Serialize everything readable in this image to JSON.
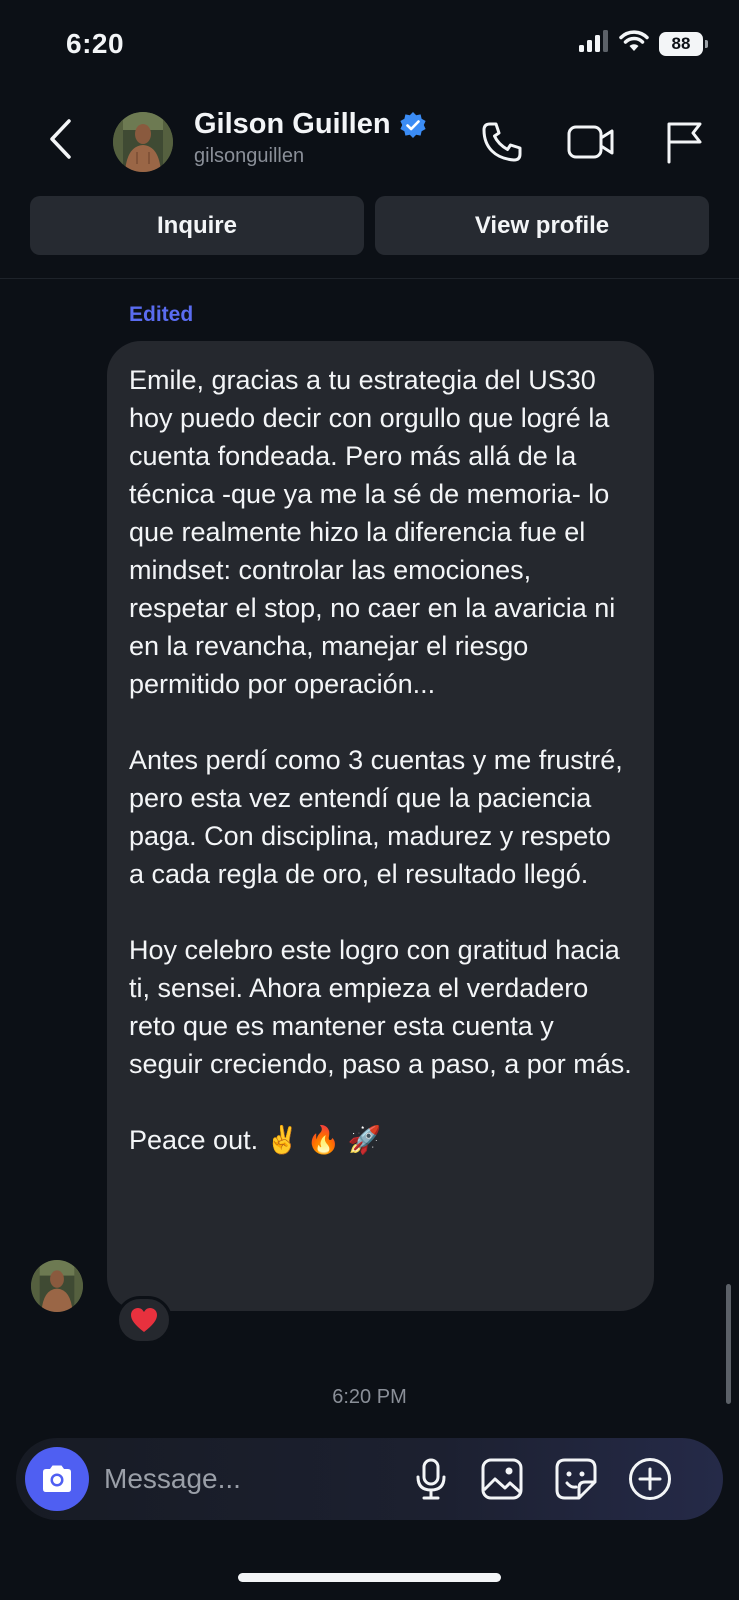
{
  "status_bar": {
    "time": "6:20",
    "battery": "88"
  },
  "header": {
    "contact_name": "Gilson Guillen",
    "handle": "gilsonguillen",
    "verified": true,
    "icons": [
      "back-icon",
      "phone-icon",
      "video-icon",
      "flag-icon"
    ]
  },
  "actions": {
    "inquire": "Inquire",
    "view_profile": "View profile"
  },
  "conversation": {
    "edited_label": "Edited",
    "message_paragraphs": [
      "Emile, gracias a tu estrategia del US30 hoy puedo decir con orgullo que logré la cuenta fondeada. Pero más allá de la técnica -que ya me la sé de memoria- lo que realmente hizo la diferencia fue el mindset: controlar las emociones, respetar el stop, no caer en la avaricia ni en la revancha, manejar el riesgo permitido por operación...",
      "Antes perdí como 3 cuentas y me frustré, pero esta vez entendí que la paciencia paga. Con disciplina, madurez y respeto a cada regla de oro, el resultado llegó.",
      "Hoy celebro este logro con gratitud hacia ti, sensei. Ahora empieza el verdadero reto que es mantener esta cuenta y seguir creciendo, paso a paso, a por más.",
      "Peace out. ✌️ 🔥 🚀"
    ],
    "reaction": "heart-icon",
    "timestamp": "6:20 PM"
  },
  "composer": {
    "placeholder": "Message...",
    "icons": [
      "camera-icon",
      "microphone-icon",
      "gallery-icon",
      "sticker-icon",
      "plus-circle-icon"
    ]
  },
  "colors": {
    "background": "#0c1016",
    "bubble": "#25282e",
    "accent": "#4f5ff2",
    "edited": "#5a6cf0",
    "verified": "#3b8cf5",
    "reaction": "#e8313e"
  }
}
